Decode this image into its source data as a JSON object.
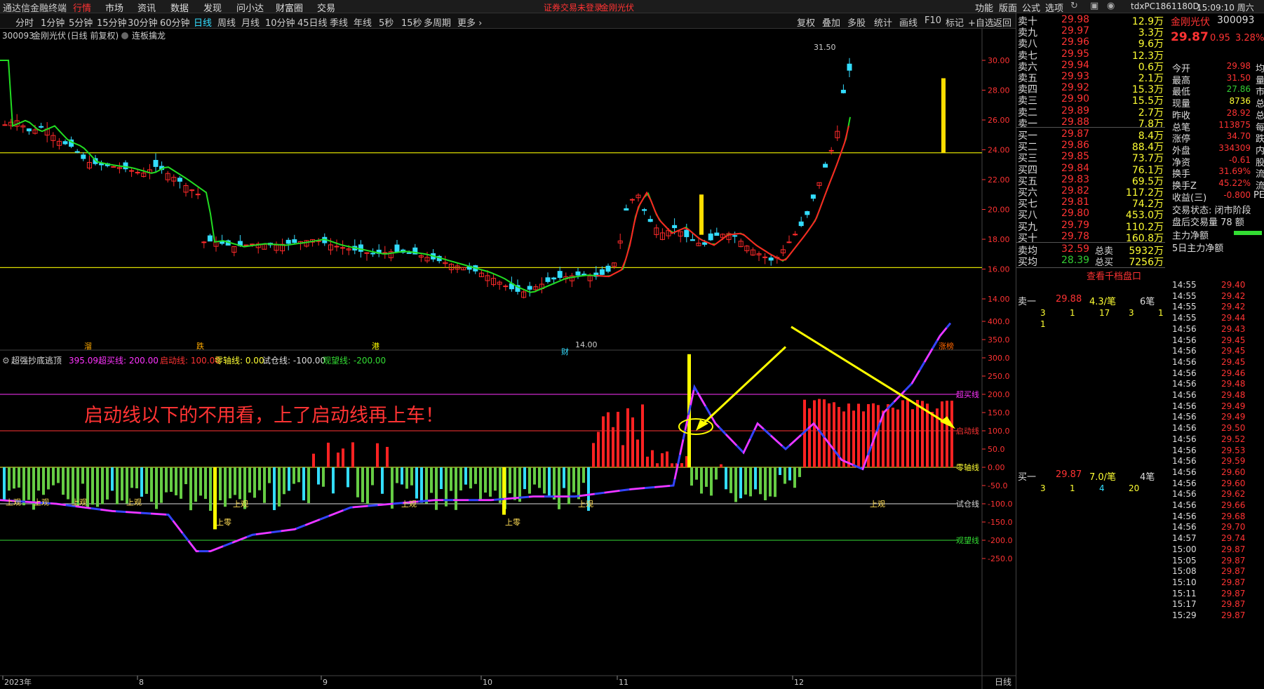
{
  "app": {
    "title": "通达信金融终端",
    "menu": [
      "行情",
      "市场",
      "资讯",
      "数据",
      "发现",
      "问小达",
      "财富圈",
      "交易"
    ],
    "notice": "证券交易未登录",
    "notice_stock": "金刚光伏",
    "right_menu": [
      "功能",
      "版面",
      "公式",
      "选项"
    ],
    "client_id": "tdxPC1861180D",
    "clock": "15:09:10 周六"
  },
  "timeframes": [
    "分时",
    "1分钟",
    "5分钟",
    "15分钟",
    "30分钟",
    "60分钟",
    "日线",
    "周线",
    "月线",
    "10分钟",
    "45日线",
    "季线",
    "年线",
    "5秒",
    "15秒",
    "多周期",
    "更多 ›"
  ],
  "active_timeframe": "日线",
  "toolbar": [
    "复权",
    "叠加",
    "多股",
    "统计",
    "画线",
    "F10",
    "标记",
    "+自选",
    "返回"
  ],
  "kline": {
    "header_code": "300093",
    "header_name": "金刚光伏",
    "header_mode": "(日线 前复权)",
    "header_indicator": "连板擒龙",
    "y_ticks": [
      "30.00",
      "28.00",
      "26.00",
      "24.00",
      "22.00",
      "20.00",
      "18.00",
      "16.00",
      "14.00"
    ],
    "high_label": "31.50",
    "low_label": "14.00",
    "markers": [
      "溜",
      "跌",
      "港",
      "财",
      "涨榜"
    ],
    "colors": {
      "up": "#ff2a2a",
      "down": "#33ddff",
      "ma_up": "#ff2222",
      "ma_down": "#22dd22",
      "hline": "#dddd00",
      "signal": "#ffdd00"
    }
  },
  "indicator": {
    "name": "超强抄底逃顶",
    "value": "395.09",
    "lines": [
      {
        "label": "超买线: 200.00",
        "color": "#ff33ff"
      },
      {
        "label": "启动线: 100.00",
        "color": "#ff3333"
      },
      {
        "label": "零轴线: 0.00",
        "color": "#ffff33"
      },
      {
        "label": "试仓线: -100.00",
        "color": "#dddddd"
      },
      {
        "label": "观望线: -200.00",
        "color": "#33dd33"
      }
    ],
    "y_ticks": [
      "400.0",
      "350.0",
      "300.0",
      "250.0",
      "200.0",
      "150.0",
      "100.0",
      "50.0",
      "0.00",
      "-50.0",
      "-100.0",
      "-150.0",
      "-200.0",
      "-250.0"
    ],
    "line_labels": [
      "超买线",
      "启动线",
      "零轴线",
      "试仓线",
      "观望线"
    ],
    "annotation": "启动线以下的不用看，上了启动线再上车！",
    "signals": [
      "上观",
      "上观",
      "上观",
      "上观",
      "上观",
      "上零",
      "上观",
      "上零",
      "上观",
      "上观"
    ]
  },
  "x_axis": [
    "2023年",
    "8",
    "9",
    "10",
    "11",
    "12"
  ],
  "x_axis_right": "日线",
  "quote": {
    "code": "300093",
    "name": "金刚光伏",
    "price": "29.87",
    "change": "0.95",
    "pct": "3.28%",
    "asks": [
      {
        "label": "卖十",
        "price": "29.98",
        "vol": "12.9万"
      },
      {
        "label": "卖九",
        "price": "29.97",
        "vol": "3.3万"
      },
      {
        "label": "卖八",
        "price": "29.96",
        "vol": "9.6万"
      },
      {
        "label": "卖七",
        "price": "29.95",
        "vol": "12.3万"
      },
      {
        "label": "卖六",
        "price": "29.94",
        "vol": "0.6万"
      },
      {
        "label": "卖五",
        "price": "29.93",
        "vol": "2.1万"
      },
      {
        "label": "卖四",
        "price": "29.92",
        "vol": "15.3万"
      },
      {
        "label": "卖三",
        "price": "29.90",
        "vol": "15.5万"
      },
      {
        "label": "卖二",
        "price": "29.89",
        "vol": "2.7万"
      },
      {
        "label": "卖一",
        "price": "29.88",
        "vol": "7.8万"
      }
    ],
    "bids": [
      {
        "label": "买一",
        "price": "29.87",
        "vol": "8.4万"
      },
      {
        "label": "买二",
        "price": "29.86",
        "vol": "88.4万"
      },
      {
        "label": "买三",
        "price": "29.85",
        "vol": "73.7万"
      },
      {
        "label": "买四",
        "price": "29.84",
        "vol": "76.1万"
      },
      {
        "label": "买五",
        "price": "29.83",
        "vol": "69.5万"
      },
      {
        "label": "买六",
        "price": "29.82",
        "vol": "117.2万"
      },
      {
        "label": "买七",
        "price": "29.81",
        "vol": "74.2万"
      },
      {
        "label": "买八",
        "price": "29.80",
        "vol": "453.0万"
      },
      {
        "label": "买九",
        "price": "29.79",
        "vol": "110.2万"
      },
      {
        "label": "买十",
        "price": "29.78",
        "vol": "160.8万"
      }
    ],
    "avg_sell": {
      "label": "卖均",
      "price": "32.59",
      "tlabel": "总卖",
      "vol": "5932万"
    },
    "avg_buy": {
      "label": "买均",
      "price": "28.39",
      "tlabel": "总买",
      "vol": "7256万"
    },
    "stats": [
      {
        "label": "今开",
        "value": "29.98",
        "tail": "均"
      },
      {
        "label": "最高",
        "value": "31.50",
        "tail": "量"
      },
      {
        "label": "最低",
        "value": "27.86",
        "tail": "市"
      },
      {
        "label": "现量",
        "value": "8736",
        "tail": "总"
      },
      {
        "label": "昨收",
        "value": "28.92",
        "tail": "总"
      },
      {
        "label": "总笔",
        "value": "113875",
        "tail": "每"
      },
      {
        "label": "涨停",
        "value": "34.70",
        "tail": "跌"
      },
      {
        "label": "外盘",
        "value": "334309",
        "tail": "内"
      },
      {
        "label": "净资",
        "value": "-0.61",
        "tail": "股"
      },
      {
        "label": "换手",
        "value": "31.69%",
        "tail": "流"
      },
      {
        "label": "换手Z",
        "value": "45.22%",
        "tail": "流"
      },
      {
        "label": "收益(三)",
        "value": "-0.800",
        "tail": "PE"
      }
    ],
    "trade_state": "交易状态: 闭市阶段",
    "after_hours": "盘后交易量 78 额",
    "main_net": "主力净额",
    "main_net5": "5日主力净额",
    "view_1000": "查看千档盘口",
    "sell1_row": {
      "label": "卖一",
      "price": "29.88",
      "per": "4.3/笔",
      "count": "6笔"
    },
    "sell1_queue": [
      "3",
      "1",
      "17",
      "3",
      "1",
      "1"
    ],
    "buy1_row": {
      "label": "买一",
      "price": "29.87",
      "per": "7.0/笔",
      "count": "4笔"
    },
    "buy1_queue": [
      "3",
      "1",
      "4",
      "20"
    ]
  },
  "ticks": [
    {
      "t": "14:55",
      "p": "29.40"
    },
    {
      "t": "14:55",
      "p": "29.42"
    },
    {
      "t": "14:55",
      "p": "29.42"
    },
    {
      "t": "14:55",
      "p": "29.44"
    },
    {
      "t": "14:56",
      "p": "29.43"
    },
    {
      "t": "14:56",
      "p": "29.45"
    },
    {
      "t": "14:56",
      "p": "29.45"
    },
    {
      "t": "14:56",
      "p": "29.45"
    },
    {
      "t": "14:56",
      "p": "29.46"
    },
    {
      "t": "14:56",
      "p": "29.48"
    },
    {
      "t": "14:56",
      "p": "29.48"
    },
    {
      "t": "14:56",
      "p": "29.49"
    },
    {
      "t": "14:56",
      "p": "29.49"
    },
    {
      "t": "14:56",
      "p": "29.50"
    },
    {
      "t": "14:56",
      "p": "29.52"
    },
    {
      "t": "14:56",
      "p": "29.53"
    },
    {
      "t": "14:56",
      "p": "29.59"
    },
    {
      "t": "14:56",
      "p": "29.60"
    },
    {
      "t": "14:56",
      "p": "29.60"
    },
    {
      "t": "14:56",
      "p": "29.62"
    },
    {
      "t": "14:56",
      "p": "29.66"
    },
    {
      "t": "14:56",
      "p": "29.68"
    },
    {
      "t": "14:56",
      "p": "29.70"
    },
    {
      "t": "14:57",
      "p": "29.74"
    },
    {
      "t": "15:00",
      "p": "29.87"
    },
    {
      "t": "15:05",
      "p": "29.87"
    },
    {
      "t": "15:08",
      "p": "29.87"
    },
    {
      "t": "15:10",
      "p": "29.87"
    },
    {
      "t": "15:11",
      "p": "29.87"
    },
    {
      "t": "15:17",
      "p": "29.87"
    },
    {
      "t": "15:29",
      "p": "29.87"
    }
  ]
}
